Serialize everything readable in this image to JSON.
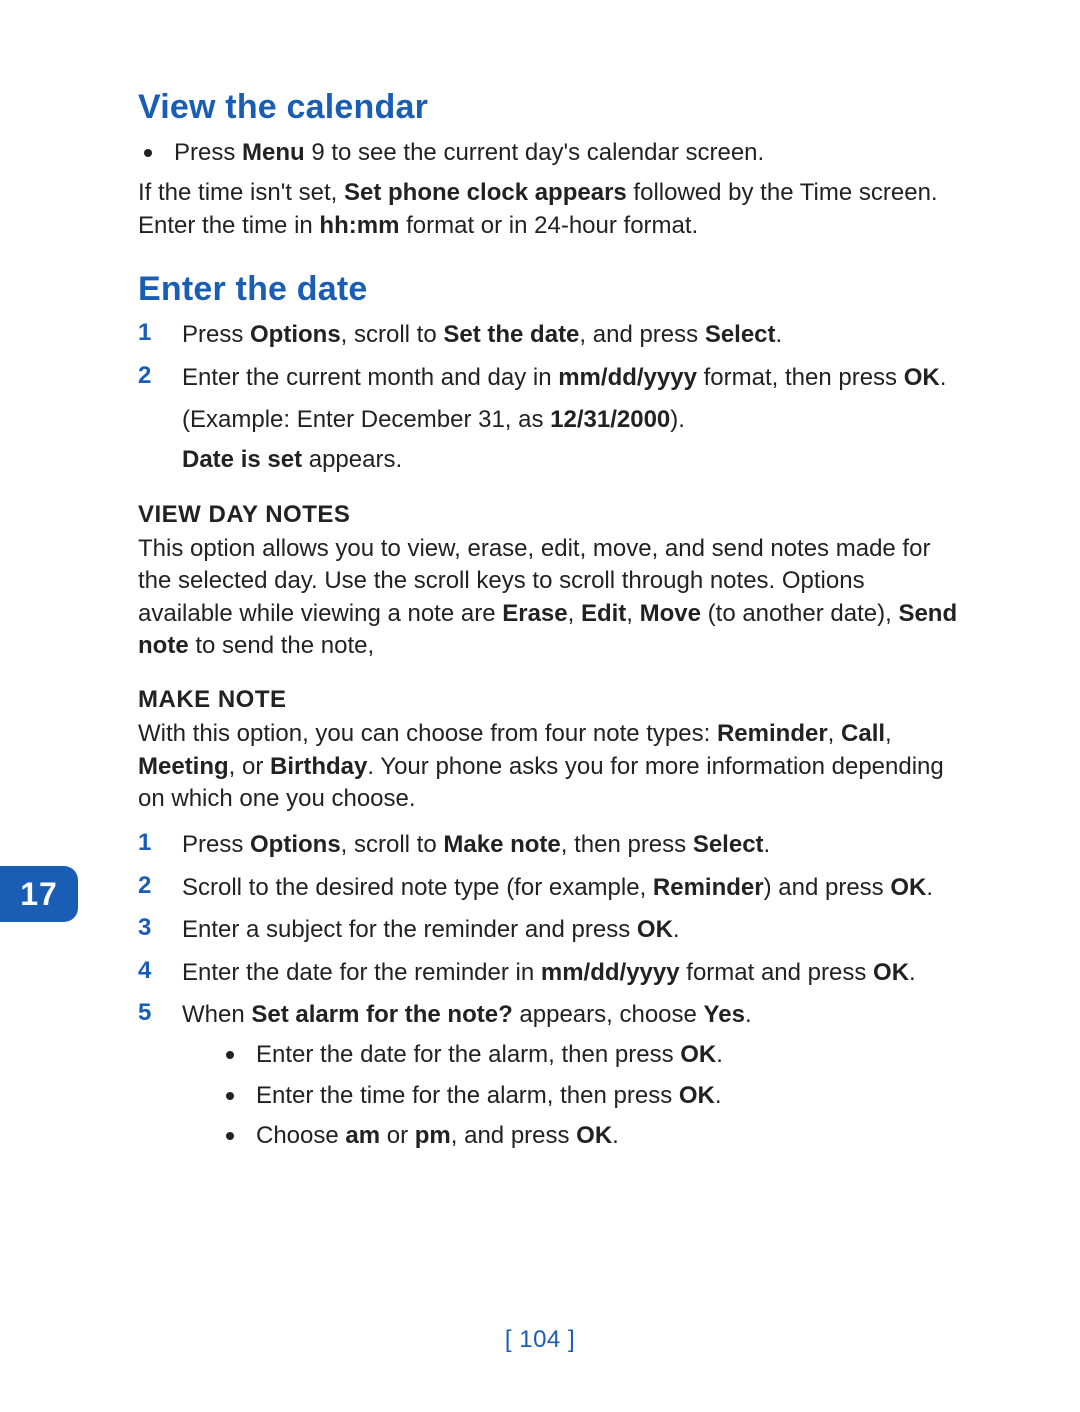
{
  "sideTab": "17",
  "pageNumber": "[ 104 ]",
  "section1": {
    "title": "View the calendar",
    "bullet1_pre": "Press ",
    "bullet1_bold": "Menu",
    "bullet1_post": " 9 to see the current day's calendar screen.",
    "para1_a": "If the time isn't set, ",
    "para1_b": "Set phone clock appears",
    "para1_c": " followed by the Time screen. Enter the time in ",
    "para1_d": "hh:mm",
    "para1_e": " format or in 24-hour format."
  },
  "section2": {
    "title": "Enter the date",
    "step1_a": "Press ",
    "step1_b": "Options",
    "step1_c": ", scroll to ",
    "step1_d": "Set the date",
    "step1_e": ", and press ",
    "step1_f": "Select",
    "step1_g": ".",
    "step2_a": "Enter the current month and day in ",
    "step2_b": "mm/dd/yyyy",
    "step2_c": " format, then press ",
    "step2_d": "OK",
    "step2_e": ".",
    "example_a": "(Example:  Enter December 31, as ",
    "example_b": "12/31/2000",
    "example_c": ").",
    "result_a": "Date is set",
    "result_b": " appears."
  },
  "viewDayNotes": {
    "head": "VIEW DAY NOTES",
    "p_a": "This option allows you to view, erase, edit, move, and send notes made for the selected day. Use the scroll keys to scroll through notes. Options available while viewing a note are ",
    "p_b": "Erase",
    "p_c": ", ",
    "p_d": "Edit",
    "p_e": ", ",
    "p_f": "Move",
    "p_g": " (to another date), ",
    "p_h": "Send note",
    "p_i": " to send the note,"
  },
  "makeNote": {
    "head": "MAKE NOTE",
    "intro_a": "With this option, you can choose from four note types: ",
    "intro_b": "Reminder",
    "intro_c": ", ",
    "intro_d": "Call",
    "intro_e": ", ",
    "intro_f": "Meeting",
    "intro_g": ", or ",
    "intro_h": "Birthday",
    "intro_i": ". Your phone asks you for more information depending on which one you choose.",
    "s1_a": "Press ",
    "s1_b": "Options",
    "s1_c": ", scroll to ",
    "s1_d": "Make note",
    "s1_e": ", then press ",
    "s1_f": "Select",
    "s1_g": ".",
    "s2_a": "Scroll to the desired note type (for example, ",
    "s2_b": "Reminder",
    "s2_c": ") and press ",
    "s2_d": "OK",
    "s2_e": ".",
    "s3_a": "Enter a subject for the reminder and press ",
    "s3_b": "OK",
    "s3_c": ".",
    "s4_a": "Enter the date for the reminder in ",
    "s4_b": "mm/dd/yyyy",
    "s4_c": " format and press ",
    "s4_d": "OK",
    "s4_e": ".",
    "s5_a": "When ",
    "s5_b": "Set alarm for the note?",
    "s5_c": " appears, choose ",
    "s5_d": "Yes",
    "s5_e": ".",
    "sb1_a": "Enter the date for the alarm, then press ",
    "sb1_b": "OK",
    "sb1_c": ".",
    "sb2_a": "Enter the time for the alarm, then press ",
    "sb2_b": "OK",
    "sb2_c": ".",
    "sb3_a": "Choose ",
    "sb3_b": "am",
    "sb3_c": " or ",
    "sb3_d": "pm",
    "sb3_e": ", and press ",
    "sb3_f": "OK",
    "sb3_g": "."
  },
  "numbers": {
    "n1": "1",
    "n2": "2",
    "n3": "3",
    "n4": "4",
    "n5": "5"
  }
}
